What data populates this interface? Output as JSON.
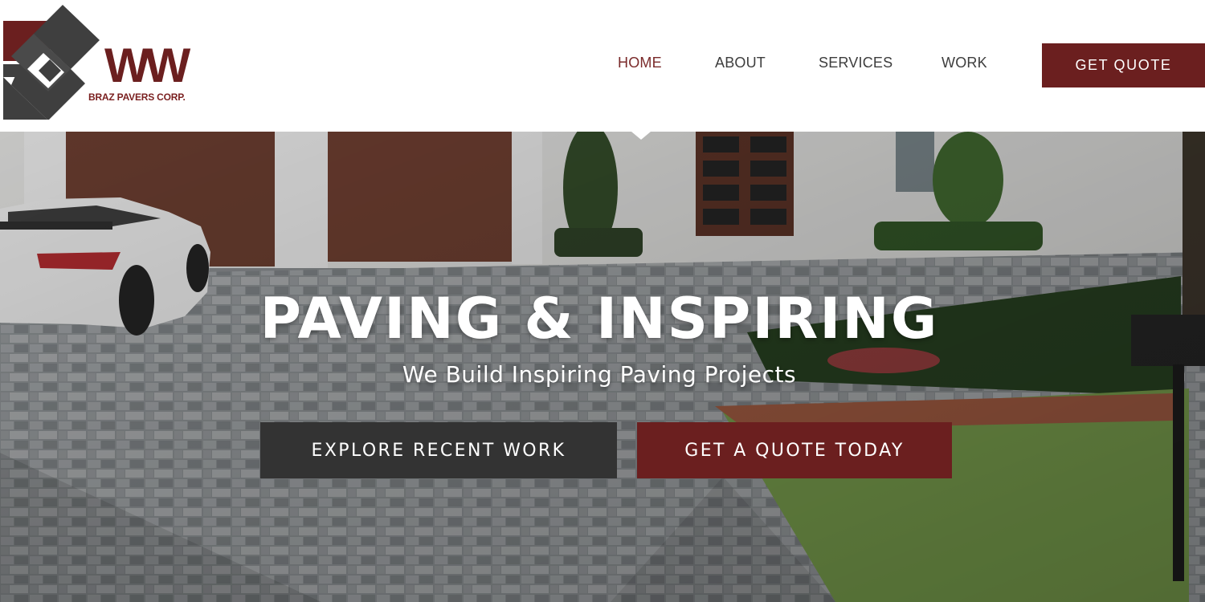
{
  "brand": {
    "name": "BRAZ PAVERS CORP.",
    "monogram": "WW",
    "colors": {
      "primary": "#6b1f1f",
      "dark": "#333333",
      "logo_gray": "#3f3f3f"
    }
  },
  "nav": {
    "items": [
      {
        "label": "HOME",
        "active": true
      },
      {
        "label": "ABOUT",
        "active": false
      },
      {
        "label": "SERVICES",
        "active": false
      },
      {
        "label": "WORK",
        "active": false
      }
    ],
    "cta_label": "GET QUOTE"
  },
  "hero": {
    "title": "PAVING & INSPIRING",
    "subtitle": "We Build Inspiring Paving Projects",
    "buttons": {
      "explore_label": "EXPLORE RECENT WORK",
      "quote_label": "GET A QUOTE TODAY"
    }
  }
}
